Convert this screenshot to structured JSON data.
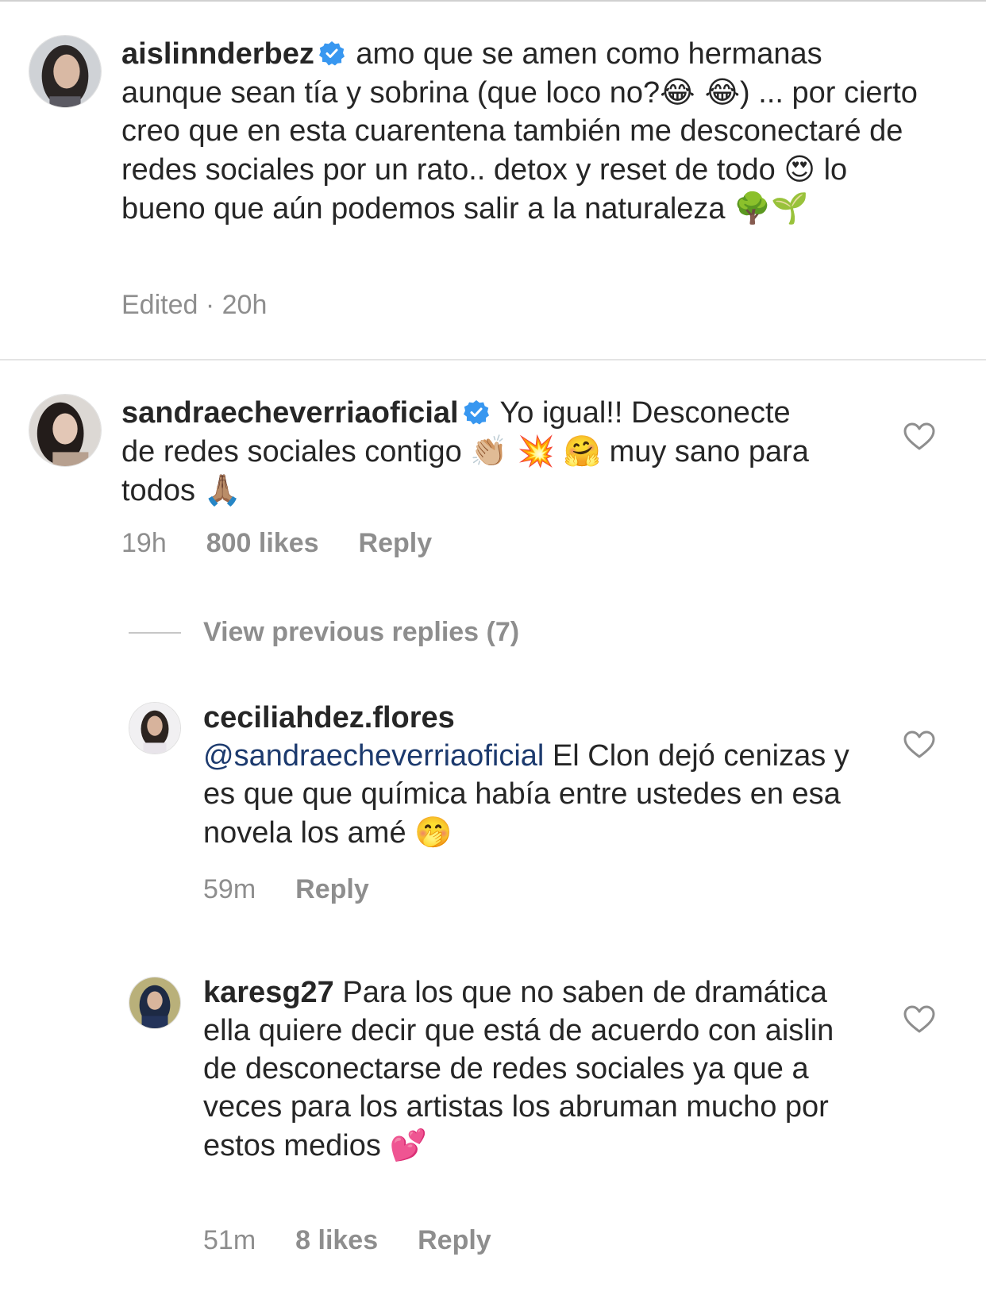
{
  "caption": {
    "username": "aislinnderbez",
    "text_1": "amo que se amen como hermanas aunque sean tía y sobrina (que loco no?",
    "emoji_1": "😂 😂",
    "text_2": ") ... por cierto creo que en esta cuarentena también me desconectaré de redes sociales por un rato.. detox y reset de todo",
    "emoji_2": "😍",
    "text_3": "lo bueno que aún podemos salir a la naturaleza",
    "emoji_3": "🌳🌱",
    "edited": "Edited",
    "time": "20h"
  },
  "comments": [
    {
      "username": "sandraecheverriaoficial",
      "text_1": "Yo igual!! Desconecte de redes sociales contigo",
      "emoji_1": "👏🏼 💥",
      "emoji_2": "🤗",
      "text_2": "muy sano para todos",
      "emoji_3": "🙏🏽",
      "time": "19h",
      "likes": "800 likes",
      "reply": "Reply"
    }
  ],
  "view_previous_replies": "View previous replies (7)",
  "replies": [
    {
      "username": "ceciliahdez.flores",
      "mention": "@sandraecheverriaoficial",
      "text": "El Clon dejó cenizas y es que que química había entre ustedes en esa novela los amé",
      "emoji": "🤭",
      "time": "59m",
      "reply": "Reply"
    },
    {
      "username": "karesg27",
      "text": "Para los que no saben de dramática ella quiere decir que está de acuerdo con aislin de desconectarse de redes sociales ya que a veces para los artistas los abruman mucho por estos medios",
      "emoji": "💕",
      "time": "51m",
      "likes": "8 likes",
      "reply": "Reply"
    }
  ],
  "colors": {
    "text": "#262626",
    "secondary": "#8e8e8e",
    "mention": "#1c3a6e",
    "verified": "#3897f0"
  },
  "icons": [
    "verified-badge-icon",
    "heart-icon"
  ]
}
